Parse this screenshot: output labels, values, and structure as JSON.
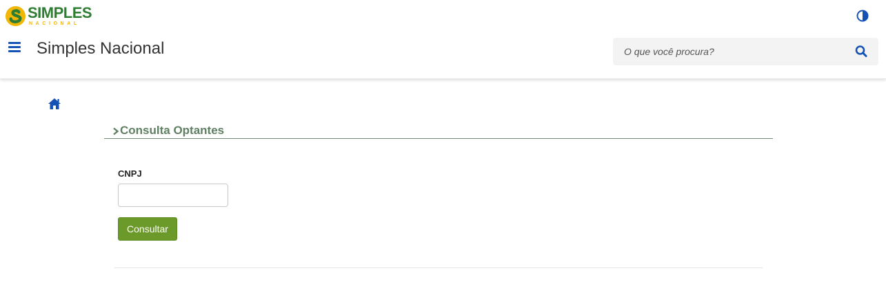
{
  "header": {
    "logo_main": "SIMPLES",
    "logo_sub": "NACIONAL",
    "site_title": "Simples Nacional",
    "search": {
      "placeholder": "O que você procura?",
      "value": ""
    },
    "icons": {
      "contrast": "contrast-icon",
      "menu": "hamburger-menu-icon",
      "search": "search-icon"
    }
  },
  "breadcrumb": {
    "home_icon": "home-icon"
  },
  "section": {
    "title": "Consulta Optantes"
  },
  "form": {
    "cnpj_label": "CNPJ",
    "cnpj_value": "",
    "submit_label": "Consultar"
  },
  "colors": {
    "accent_blue": "#1351b4",
    "section_green": "#5f7f63",
    "button_green": "#6c9a2a",
    "logo_green": "#2e7d32",
    "logo_yellow": "#f2b705"
  }
}
